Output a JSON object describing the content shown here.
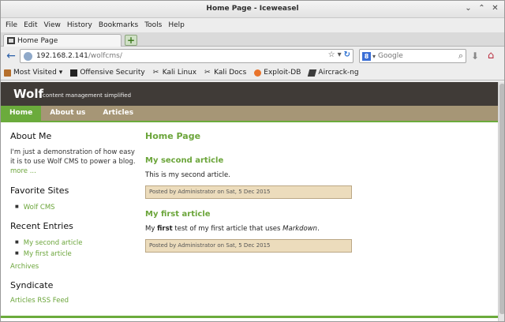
{
  "window": {
    "title": "Home Page - Iceweasel",
    "controls": {
      "minimize": "⌄",
      "maximize": "⌃",
      "close": "✕"
    }
  },
  "menu": [
    "File",
    "Edit",
    "View",
    "History",
    "Bookmarks",
    "Tools",
    "Help"
  ],
  "tab": {
    "label": "Home Page"
  },
  "address": {
    "host": "192.168.2.141",
    "path": "/wolfcms/"
  },
  "search": {
    "placeholder": "Google",
    "engine_letter": "8"
  },
  "bookmarks": [
    {
      "label": "Most Visited",
      "icon": "most-visited-icon"
    },
    {
      "label": "Offensive Security",
      "icon": "offensive-security-icon"
    },
    {
      "label": "Kali Linux",
      "icon": "kali-dragon-icon"
    },
    {
      "label": "Kali Docs",
      "icon": "kali-dragon-icon"
    },
    {
      "label": "Exploit-DB",
      "icon": "exploit-db-icon"
    },
    {
      "label": "Aircrack-ng",
      "icon": "aircrack-icon"
    }
  ],
  "site": {
    "name": "Wolf",
    "tagline": "content management simplified",
    "nav": [
      "Home",
      "About us",
      "Articles"
    ]
  },
  "sidebar": {
    "about_heading": "About Me",
    "about_text": "I'm just a demonstration of how easy it is to use Wolf CMS to power a blog.",
    "about_more": "more ...",
    "favorites_heading": "Favorite Sites",
    "favorites": [
      "Wolf CMS"
    ],
    "recent_heading": "Recent Entries",
    "recent": [
      "My second article",
      "My first article"
    ],
    "archives": "Archives",
    "syndicate_heading": "Syndicate",
    "rss": "Articles RSS Feed"
  },
  "main": {
    "page_title": "Home Page",
    "articles": [
      {
        "title": "My second article",
        "body": "This is my second article.",
        "meta": "Posted by Administrator on Sat, 5 Dec 2015"
      },
      {
        "title": "My first article",
        "body_pre": "My ",
        "body_bold": "first",
        "body_mid": " test of my first article that uses ",
        "body_em": "Markdown",
        "body_post": ".",
        "meta": "Posted by Administrator on Sat, 5 Dec 2015"
      }
    ]
  }
}
